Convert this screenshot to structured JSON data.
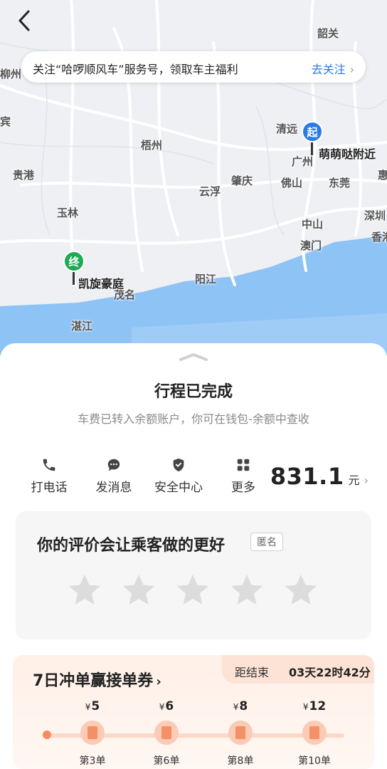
{
  "map": {
    "cities": [
      "韶关",
      "柳州",
      "宾",
      "清远",
      "梧州",
      "广州",
      "贵港",
      "肇庆",
      "东莞",
      "佛山",
      "云浮",
      "惠",
      "玉林",
      "深圳",
      "中山",
      "香港",
      "澳门",
      "阳江",
      "茂名",
      "湛江"
    ],
    "start_pin": {
      "badge": "起",
      "label": "萌萌哒附近",
      "color": "#2b7be5"
    },
    "end_pin": {
      "badge": "终",
      "label": "凯旋豪庭",
      "color": "#1faa55"
    },
    "water_color": "#8ec3f5"
  },
  "notice": {
    "text": "关注“哈啰顺风车”服务号，领取车主福利",
    "link": "去关注"
  },
  "trip": {
    "title": "行程已完成",
    "subtitle": "车费已转入余额账户，你可在钱包-余额中查收"
  },
  "actions": [
    {
      "label": "打电话",
      "icon": "phone-icon"
    },
    {
      "label": "发消息",
      "icon": "message-icon"
    },
    {
      "label": "安全中心",
      "icon": "shield-icon"
    },
    {
      "label": "更多",
      "icon": "grid-icon"
    }
  ],
  "fare": {
    "amount": "831.1",
    "unit": "元"
  },
  "rating": {
    "title": "你的评价会让乘客做的更好",
    "anon_tag": "匿名",
    "stars_total": 5,
    "stars_selected": 0
  },
  "promo": {
    "title": "7日冲单赢接单券",
    "countdown_label": "距结束",
    "countdown_value": "03天22时42分",
    "milestones": [
      {
        "currency": "¥",
        "amount": "5",
        "label": "第3单"
      },
      {
        "currency": "¥",
        "amount": "6",
        "label": "第6单"
      },
      {
        "currency": "¥",
        "amount": "8",
        "label": "第8单"
      },
      {
        "currency": "¥",
        "amount": "12",
        "label": "第10单"
      }
    ]
  }
}
